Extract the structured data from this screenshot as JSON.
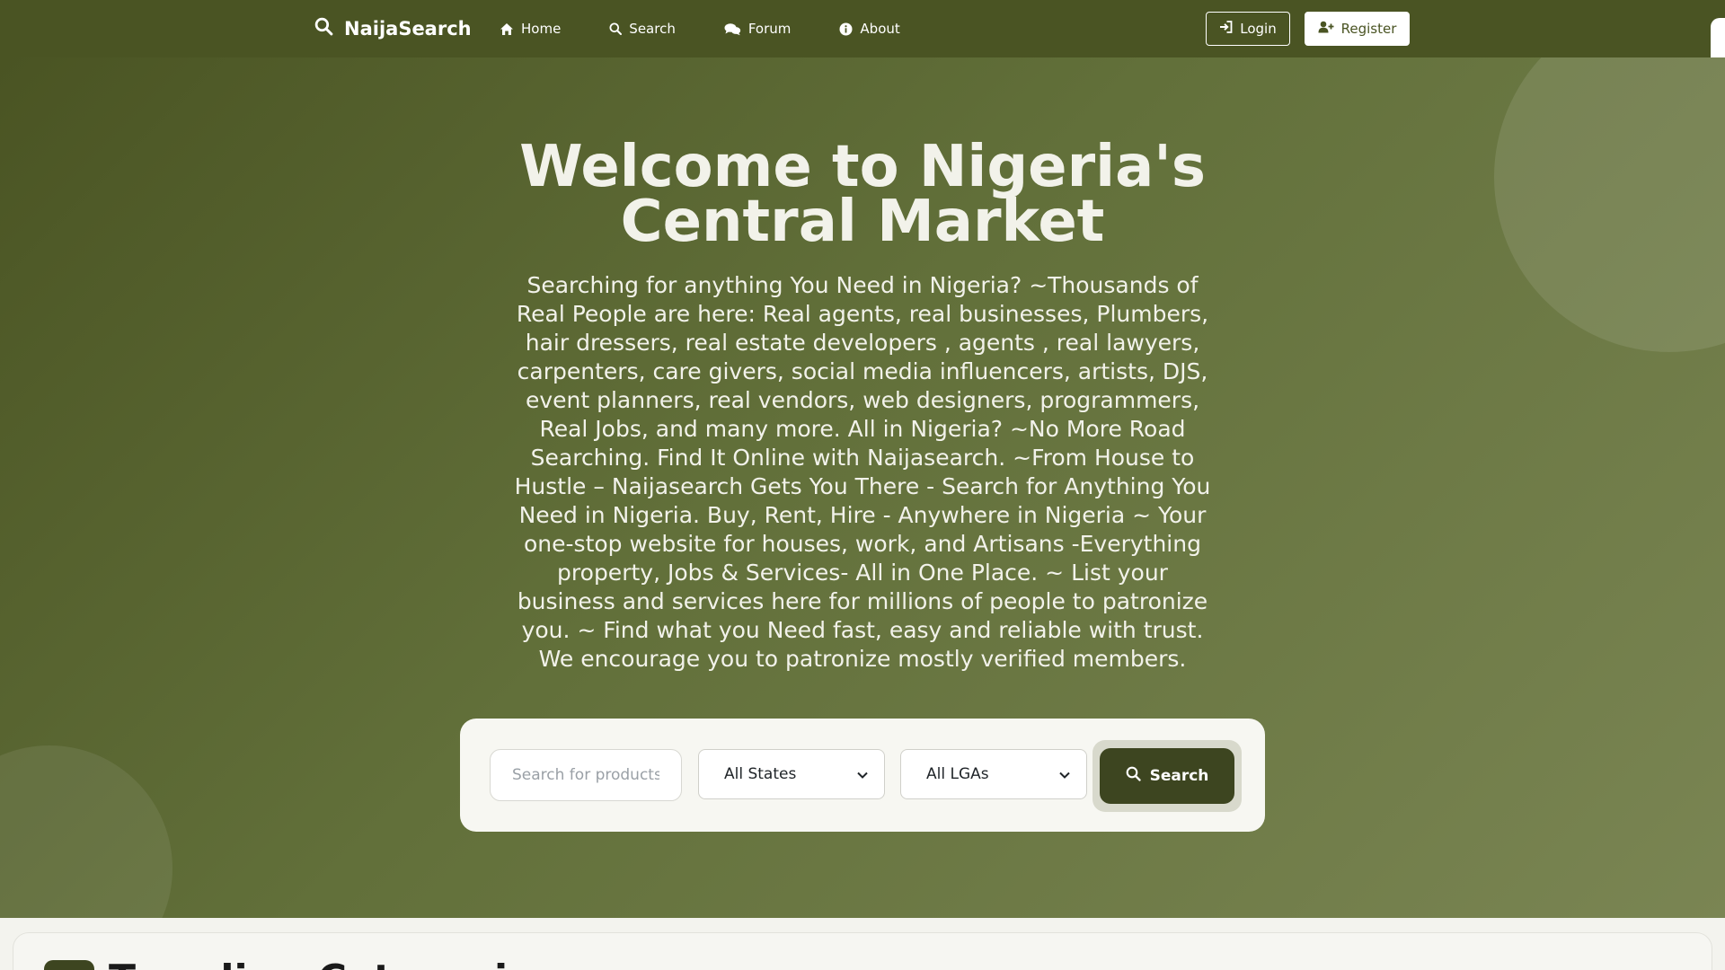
{
  "brand": {
    "name": "NaijaSearch",
    "icon": "search-icon"
  },
  "nav": {
    "items": [
      {
        "label": "Home",
        "icon": "home-icon"
      },
      {
        "label": "Search",
        "icon": "search-icon"
      },
      {
        "label": "Forum",
        "icon": "comments-icon"
      },
      {
        "label": "About",
        "icon": "info-icon"
      }
    ]
  },
  "auth": {
    "login_label": "Login",
    "register_label": "Register"
  },
  "hero": {
    "title": "Welcome to Nigeria's Central Market",
    "description": "Searching for anything You Need in Nigeria? ~Thousands of Real People are here: Real agents, real businesses, Plumbers, hair dressers, real estate developers , agents , real lawyers, carpenters, care givers, social media influencers, artists, DJS, event planners, real vendors, web designers, programmers, Real Jobs, and many more. All in Nigeria? ~No More Road Searching. Find It Online with Naijasearch. ~From House to Hustle – Naijasearch Gets You There - Search for Anything You Need in Nigeria. Buy, Rent, Hire - Anywhere in Nigeria ~ Your one-stop website for houses, work, and Artisans -Everything property, Jobs & Services- All in One Place. ~ List your business and services here for millions of people to patronize you. ~ Find what you Need fast, easy and reliable with trust. We encourage you to patronize mostly verified members."
  },
  "search": {
    "placeholder": "Search for products, services...",
    "state_selected": "All States",
    "lga_selected": "All LGAs",
    "button_label": "Search"
  },
  "trending": {
    "title": "Trending Categories"
  },
  "colors": {
    "nav_bg": "#4a5423",
    "hero_start": "#4a5423",
    "hero_end": "#7a8553",
    "search_button": "#3d4520"
  }
}
